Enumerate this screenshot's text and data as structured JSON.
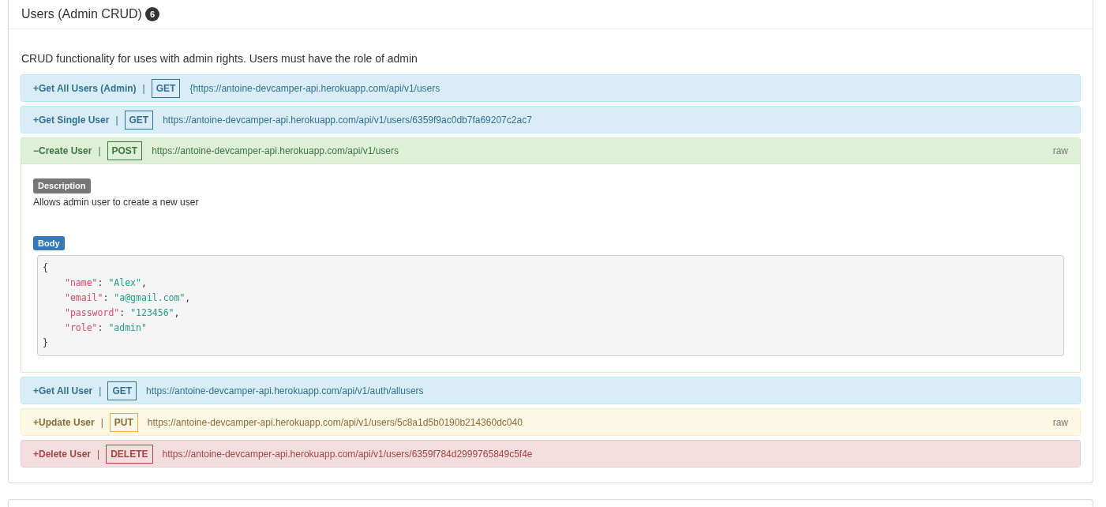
{
  "section": {
    "title": "Users (Admin CRUD)",
    "count": "6",
    "description": "CRUD functionality for uses with admin rights. Users must have the role of admin"
  },
  "endpoints": [
    {
      "name": "+Get All Users (Admin)",
      "separator": "|",
      "method": "GET",
      "kind": "get",
      "url": "{https://antoine-devcamper-api.herokuapp.com/api/v1/users",
      "expanded": false
    },
    {
      "name": "+Get Single User",
      "separator": "|",
      "method": "GET",
      "kind": "get",
      "url": "https://antoine-devcamper-api.herokuapp.com/api/v1/users/6359f9ac0db7fa69207c2ac7",
      "expanded": false
    },
    {
      "name": "−Create User",
      "separator": "|",
      "method": "POST",
      "kind": "post",
      "url": "https://antoine-devcamper-api.herokuapp.com/api/v1/users",
      "raw": "raw",
      "expanded": true,
      "description_label": "Description",
      "description": "Allows admin user to create a new user",
      "body_label": "Body",
      "body": {
        "open": "{",
        "close": "}",
        "entries": [
          {
            "key": "\"name\"",
            "colon": ":",
            "value": "\"Alex\"",
            "comma": ","
          },
          {
            "key": "\"email\"",
            "colon": ":",
            "value": "\"a@gmail.com\"",
            "comma": ","
          },
          {
            "key": "\"password\"",
            "colon": ":",
            "value": "\"123456\"",
            "comma": ","
          },
          {
            "key": "\"role\"",
            "colon": ":",
            "value": "\"admin\""
          }
        ]
      }
    },
    {
      "name": "+Get All User",
      "separator": "|",
      "method": "GET",
      "kind": "get",
      "url": "https://antoine-devcamper-api.herokuapp.com/api/v1/auth/allusers",
      "expanded": false
    },
    {
      "name": "+Update User",
      "separator": "|",
      "method": "PUT",
      "kind": "put",
      "url": "https://antoine-devcamper-api.herokuapp.com/api/v1/users/5c8a1d5b0190b214360dc040",
      "raw": "raw",
      "expanded": false
    },
    {
      "name": "+Delete User",
      "separator": "|",
      "method": "DELETE",
      "kind": "delete",
      "url": "https://antoine-devcamper-api.herokuapp.com/api/v1/users/6359f784d2999765849c5f4e",
      "expanded": false
    }
  ]
}
